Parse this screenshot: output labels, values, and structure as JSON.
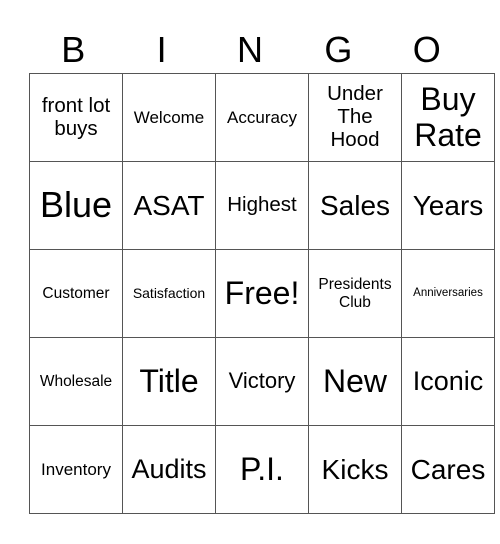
{
  "header": [
    "B",
    "I",
    "N",
    "G",
    "O"
  ],
  "rows": [
    [
      "front lot buys",
      "Welcome",
      "Accuracy",
      "Under The Hood",
      "Buy Rate"
    ],
    [
      "Blue",
      "ASAT",
      "Highest",
      "Sales",
      "Years"
    ],
    [
      "Customer",
      "Satisfaction",
      "Free!",
      "Presidents Club",
      "Anniversaries"
    ],
    [
      "Wholesale",
      "Title",
      "Victory",
      "New",
      "Iconic"
    ],
    [
      "Inventory",
      "Audits",
      "P.I.",
      "Kicks",
      "Cares"
    ]
  ]
}
